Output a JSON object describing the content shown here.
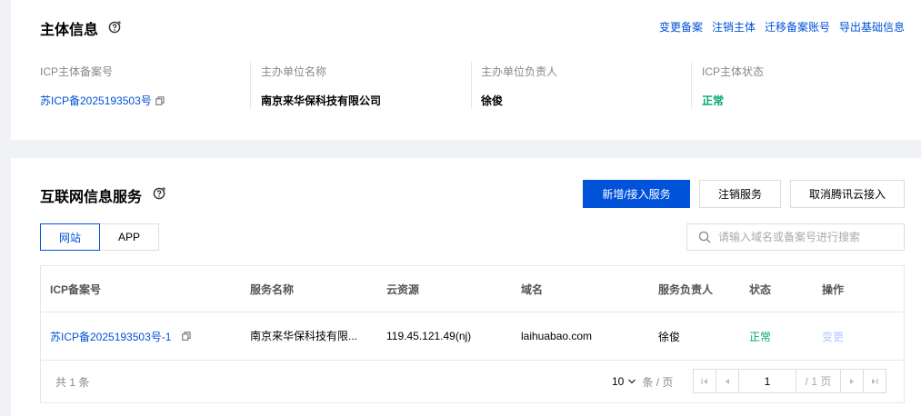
{
  "subject": {
    "title": "主体信息",
    "links": [
      "变更备案",
      "注销主体",
      "迁移备案账号",
      "导出基础信息"
    ],
    "fields": [
      {
        "label": "ICP主体备案号",
        "value": "苏ICP备2025193503号"
      },
      {
        "label": "主办单位名称",
        "value": "南京来华保科技有限公司"
      },
      {
        "label": "主办单位负责人",
        "value": "徐俊"
      },
      {
        "label": "ICP主体状态",
        "value": "正常"
      }
    ]
  },
  "services": {
    "title": "互联网信息服务",
    "buttons": {
      "add": "新增/接入服务",
      "cancel_service": "注销服务",
      "cancel_access": "取消腾讯云接入"
    },
    "tabs": [
      "网站",
      "APP"
    ],
    "search": {
      "placeholder": "请输入域名或备案号进行搜索",
      "value": ""
    },
    "table": {
      "headers": [
        "ICP备案号",
        "服务名称",
        "云资源",
        "域名",
        "服务负责人",
        "状态",
        "操作"
      ],
      "rows": [
        [
          "苏ICP备2025193503号-1",
          "南京来华保科技有限...",
          "119.45.121.49(nj)",
          "laihuabao.com",
          "徐俊",
          "正常",
          "变更"
        ]
      ]
    },
    "footer": {
      "total": "共 1 条",
      "page_size": "10",
      "page_size_unit": "条 / 页",
      "page_input": "1",
      "page_total": "/ 1 页"
    }
  },
  "colors": {
    "accent": "#0052d9",
    "success": "#00a870",
    "disabled_link": "#b5c7ff"
  }
}
